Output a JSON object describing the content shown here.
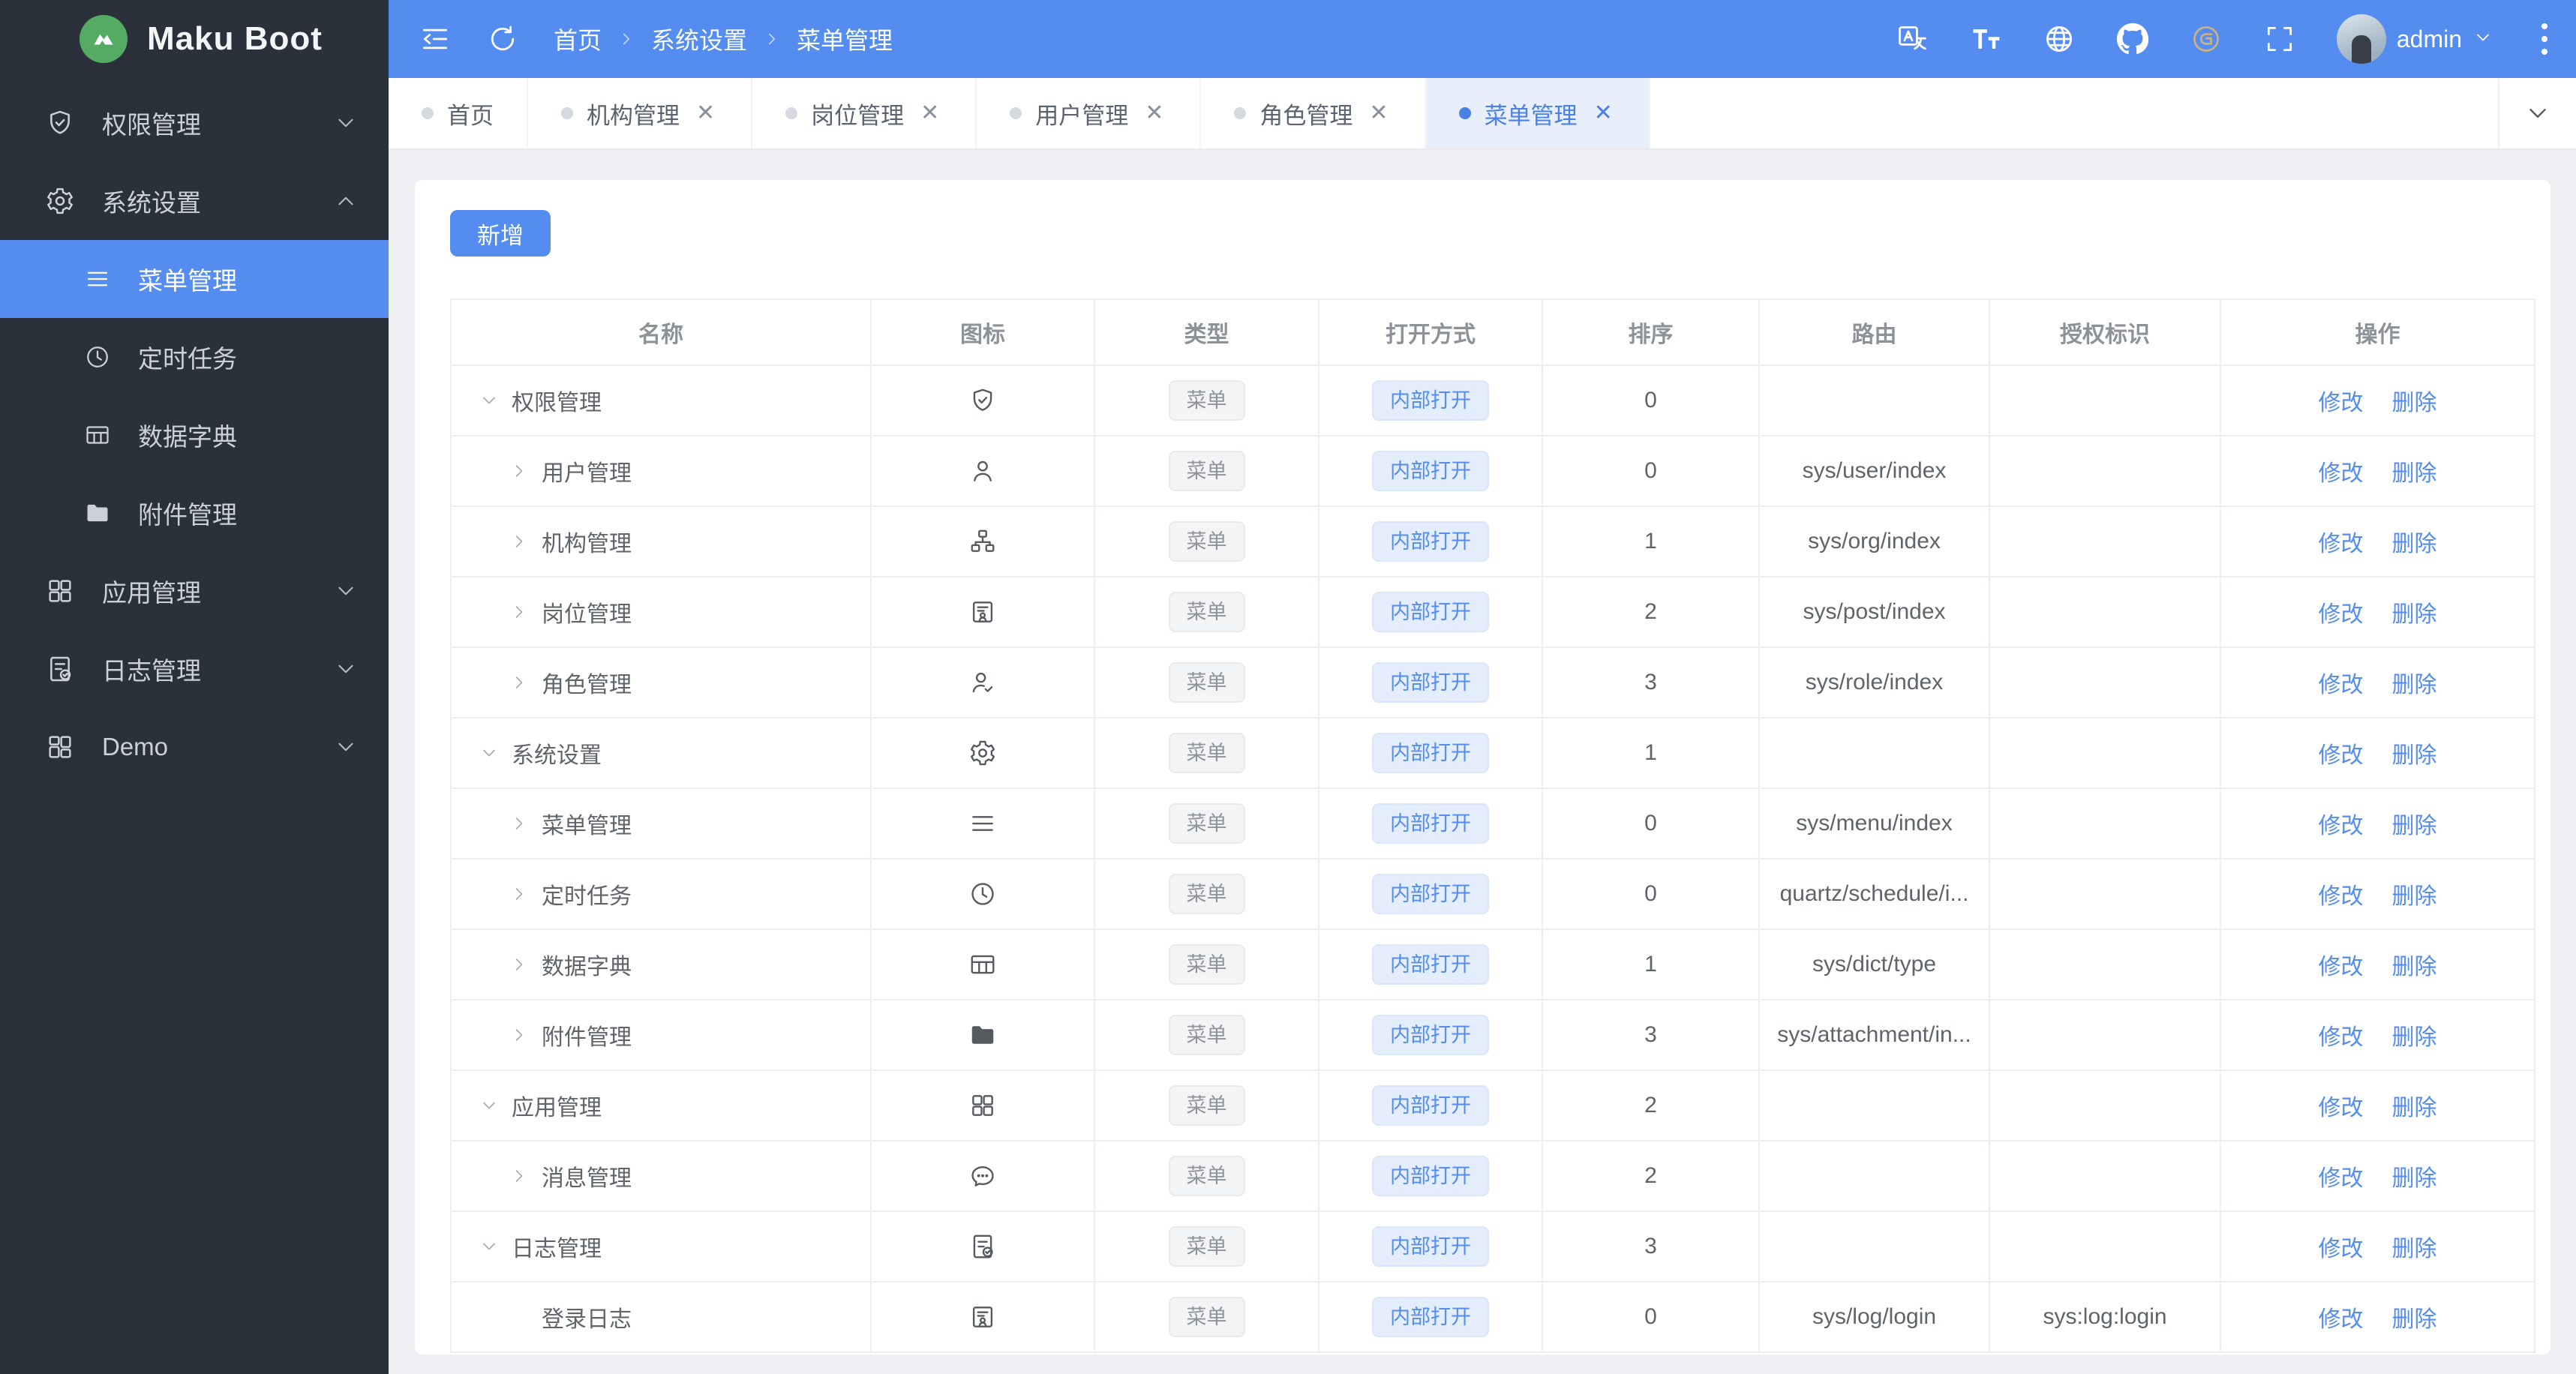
{
  "app": {
    "title": "Maku Boot"
  },
  "colors": {
    "primary": "#548cf0",
    "sidebar_bg": "#2a313a",
    "logo_green": "#55ab63",
    "active_tab_bg": "#e9eefb",
    "content_bg": "#eef0f4",
    "tag_gray_bg": "#f3f4f5",
    "tag_blue_bg": "#e4edfc"
  },
  "sidebar": {
    "items": [
      {
        "label": "权限管理",
        "icon": "shield-check-icon",
        "type": "group",
        "chevron": "down",
        "active": false
      },
      {
        "label": "系统设置",
        "icon": "gear-icon",
        "type": "group",
        "chevron": "up",
        "active": false
      },
      {
        "label": "菜单管理",
        "icon": "menu-lines-icon",
        "type": "child",
        "chevron": "",
        "active": true
      },
      {
        "label": "定时任务",
        "icon": "clock-icon",
        "type": "child",
        "chevron": "",
        "active": false
      },
      {
        "label": "数据字典",
        "icon": "table-icon",
        "type": "child",
        "chevron": "",
        "active": false
      },
      {
        "label": "附件管理",
        "icon": "folder-icon",
        "type": "child",
        "chevron": "",
        "active": false
      },
      {
        "label": "应用管理",
        "icon": "grid-icon",
        "type": "group",
        "chevron": "down",
        "active": false
      },
      {
        "label": "日志管理",
        "icon": "doc-check-icon",
        "type": "group",
        "chevron": "down",
        "active": false
      },
      {
        "label": "Demo",
        "icon": "grid-alt-icon",
        "type": "group",
        "chevron": "down",
        "active": false
      }
    ]
  },
  "header": {
    "breadcrumb": [
      "首页",
      "系统设置",
      "菜单管理"
    ],
    "username": "admin",
    "icon_names": [
      "collapse-icon",
      "refresh-icon",
      "translate-icon",
      "font-size-icon",
      "globe-icon",
      "github-icon",
      "gitee-icon",
      "fullscreen-icon",
      "kebab-icon"
    ]
  },
  "tabs": {
    "items": [
      {
        "label": "首页",
        "closable": false,
        "active": false
      },
      {
        "label": "机构管理",
        "closable": true,
        "active": false
      },
      {
        "label": "岗位管理",
        "closable": true,
        "active": false
      },
      {
        "label": "用户管理",
        "closable": true,
        "active": false
      },
      {
        "label": "角色管理",
        "closable": true,
        "active": false
      },
      {
        "label": "菜单管理",
        "closable": true,
        "active": true
      }
    ],
    "close_glyph": "✕"
  },
  "toolbar": {
    "add_label": "新增"
  },
  "table": {
    "columns": [
      "名称",
      "图标",
      "类型",
      "打开方式",
      "排序",
      "路由",
      "授权标识",
      "操作"
    ],
    "actions": [
      "修改",
      "删除"
    ],
    "rows": [
      {
        "name": "权限管理",
        "expand": "down",
        "level": "parent",
        "icon": "shield-check-icon",
        "type": "菜单",
        "open": "内部打开",
        "sort": "0",
        "route": "",
        "auth": ""
      },
      {
        "name": "用户管理",
        "expand": "right",
        "level": "child",
        "icon": "user-icon",
        "type": "菜单",
        "open": "内部打开",
        "sort": "0",
        "route": "sys/user/index",
        "auth": ""
      },
      {
        "name": "机构管理",
        "expand": "right",
        "level": "child",
        "icon": "org-tree-icon",
        "type": "菜单",
        "open": "内部打开",
        "sort": "1",
        "route": "sys/org/index",
        "auth": ""
      },
      {
        "name": "岗位管理",
        "expand": "right",
        "level": "child",
        "icon": "badge-icon",
        "type": "菜单",
        "open": "内部打开",
        "sort": "2",
        "route": "sys/post/index",
        "auth": ""
      },
      {
        "name": "角色管理",
        "expand": "right",
        "level": "child",
        "icon": "user-check-icon",
        "type": "菜单",
        "open": "内部打开",
        "sort": "3",
        "route": "sys/role/index",
        "auth": ""
      },
      {
        "name": "系统设置",
        "expand": "down",
        "level": "parent",
        "icon": "gear-icon",
        "type": "菜单",
        "open": "内部打开",
        "sort": "1",
        "route": "",
        "auth": ""
      },
      {
        "name": "菜单管理",
        "expand": "right",
        "level": "child",
        "icon": "menu-lines-icon",
        "type": "菜单",
        "open": "内部打开",
        "sort": "0",
        "route": "sys/menu/index",
        "auth": ""
      },
      {
        "name": "定时任务",
        "expand": "right",
        "level": "child",
        "icon": "clock-icon",
        "type": "菜单",
        "open": "内部打开",
        "sort": "0",
        "route": "quartz/schedule/i...",
        "auth": ""
      },
      {
        "name": "数据字典",
        "expand": "right",
        "level": "child",
        "icon": "table-icon",
        "type": "菜单",
        "open": "内部打开",
        "sort": "1",
        "route": "sys/dict/type",
        "auth": ""
      },
      {
        "name": "附件管理",
        "expand": "right",
        "level": "child",
        "icon": "folder-icon",
        "type": "菜单",
        "open": "内部打开",
        "sort": "3",
        "route": "sys/attachment/in...",
        "auth": ""
      },
      {
        "name": "应用管理",
        "expand": "down",
        "level": "parent",
        "icon": "grid-icon",
        "type": "菜单",
        "open": "内部打开",
        "sort": "2",
        "route": "",
        "auth": ""
      },
      {
        "name": "消息管理",
        "expand": "right",
        "level": "child",
        "icon": "chat-bubble-icon",
        "type": "菜单",
        "open": "内部打开",
        "sort": "2",
        "route": "",
        "auth": ""
      },
      {
        "name": "日志管理",
        "expand": "down",
        "level": "parent",
        "icon": "doc-check-icon",
        "type": "菜单",
        "open": "内部打开",
        "sort": "3",
        "route": "",
        "auth": ""
      },
      {
        "name": "登录日志",
        "expand": "none",
        "level": "leaf",
        "icon": "badge-icon",
        "type": "菜单",
        "open": "内部打开",
        "sort": "0",
        "route": "sys/log/login",
        "auth": "sys:log:login"
      }
    ]
  }
}
